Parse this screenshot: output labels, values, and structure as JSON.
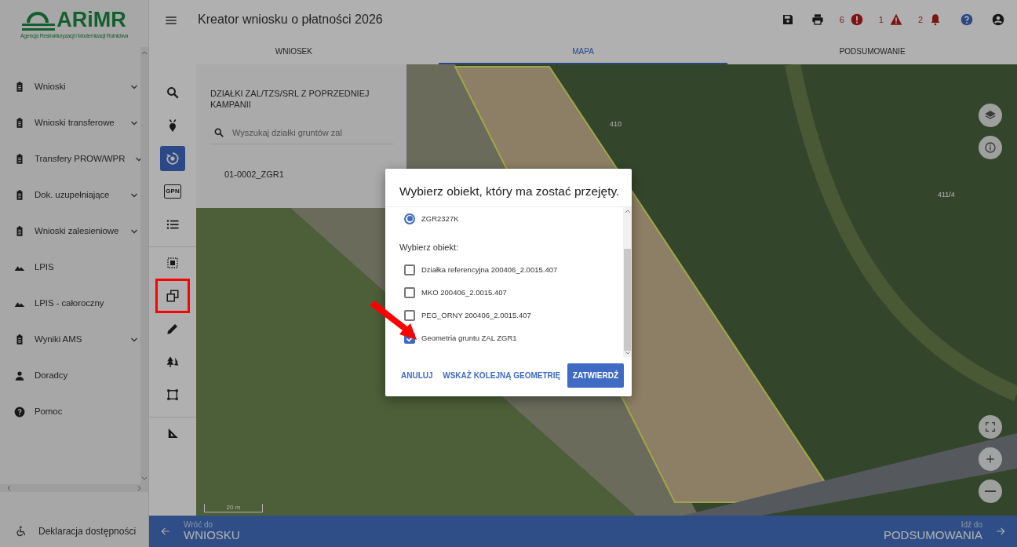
{
  "logo": {
    "name": "ARiMR",
    "subtitle": "Agencja Restrukturyzacji i Modernizacji Rolnictwa"
  },
  "sidebar": {
    "items": [
      {
        "label": "Wnioski",
        "expandable": true
      },
      {
        "label": "Wnioski transferowe",
        "expandable": true
      },
      {
        "label": "Transfery PROW/WPR",
        "expandable": true
      },
      {
        "label": "Dok. uzupełniające",
        "expandable": true
      },
      {
        "label": "Wnioski zalesieniowe",
        "expandable": true
      },
      {
        "label": "LPIS",
        "expandable": false
      },
      {
        "label": "LPIS - całoroczny",
        "expandable": false
      },
      {
        "label": "Wyniki AMS",
        "expandable": true
      },
      {
        "label": "Doradcy",
        "expandable": false
      },
      {
        "label": "Pomoc",
        "expandable": false
      }
    ],
    "footer": "Deklaracja dostępności"
  },
  "header": {
    "title": "Kreator wniosku o płatności 2026",
    "alerts": [
      {
        "count": "6"
      },
      {
        "count": "1"
      },
      {
        "count": "2"
      }
    ]
  },
  "tabs": [
    {
      "label": "WNIOSEK",
      "selected": false
    },
    {
      "label": "MAPA",
      "selected": true
    },
    {
      "label": "PODSUMOWANIE",
      "selected": false
    }
  ],
  "tool_groups": [
    [
      {
        "selected": false,
        "highlighted": false
      },
      {
        "selected": false,
        "highlighted": false
      },
      {
        "selected": true,
        "highlighted": false
      },
      {
        "selected": false,
        "highlighted": false,
        "label": "GPN"
      },
      {
        "selected": false,
        "highlighted": false
      }
    ],
    [
      {
        "selected": false,
        "highlighted": false
      },
      {
        "selected": false,
        "highlighted": true
      },
      {
        "selected": false,
        "highlighted": false
      },
      {
        "selected": false,
        "highlighted": false
      },
      {
        "selected": false,
        "highlighted": false
      }
    ],
    [
      {
        "selected": false,
        "highlighted": false
      }
    ]
  ],
  "panel": {
    "title": "DZIAŁKI ZAL/TZS/SRL Z POPRZEDNIEJ KAMPANII",
    "search": {
      "placeholder": "Wyszukaj działki gruntów zal"
    },
    "items": [
      "01-0002_ZGR1"
    ]
  },
  "map": {
    "labels": [
      "410",
      "411/4"
    ],
    "scale": "20 m"
  },
  "dialog": {
    "title": "Wybierz obiekt, który ma zostać przejęty.",
    "radios": [
      {
        "label": "ZGR2327K",
        "selected": true
      }
    ],
    "section": "Wybierz obiekt:",
    "options": [
      {
        "label": "Działka referencyjna 200406_2.0015.407",
        "checked": false,
        "highlighted": false
      },
      {
        "label": "MKO 200406_2.0015.407",
        "checked": false,
        "highlighted": false
      },
      {
        "label": "PEG_ORNY 200406_2.0015.407",
        "checked": false,
        "highlighted": false
      },
      {
        "label": "Geometria gruntu ZAL ZGR1",
        "checked": true,
        "highlighted": true
      }
    ],
    "buttons": [
      {
        "label": "ANULUJ",
        "kind": "text"
      },
      {
        "label": "WSKAŻ KOLEJNĄ GEOMETRIĘ",
        "kind": "text"
      },
      {
        "label": "ZATWIERDŹ",
        "kind": "primary"
      }
    ]
  },
  "footer_nav": {
    "back": {
      "caption": "Wróć do",
      "label": "WNIOSKU"
    },
    "next": {
      "caption": "Idź do",
      "label": "PODSUMOWANIA"
    }
  }
}
